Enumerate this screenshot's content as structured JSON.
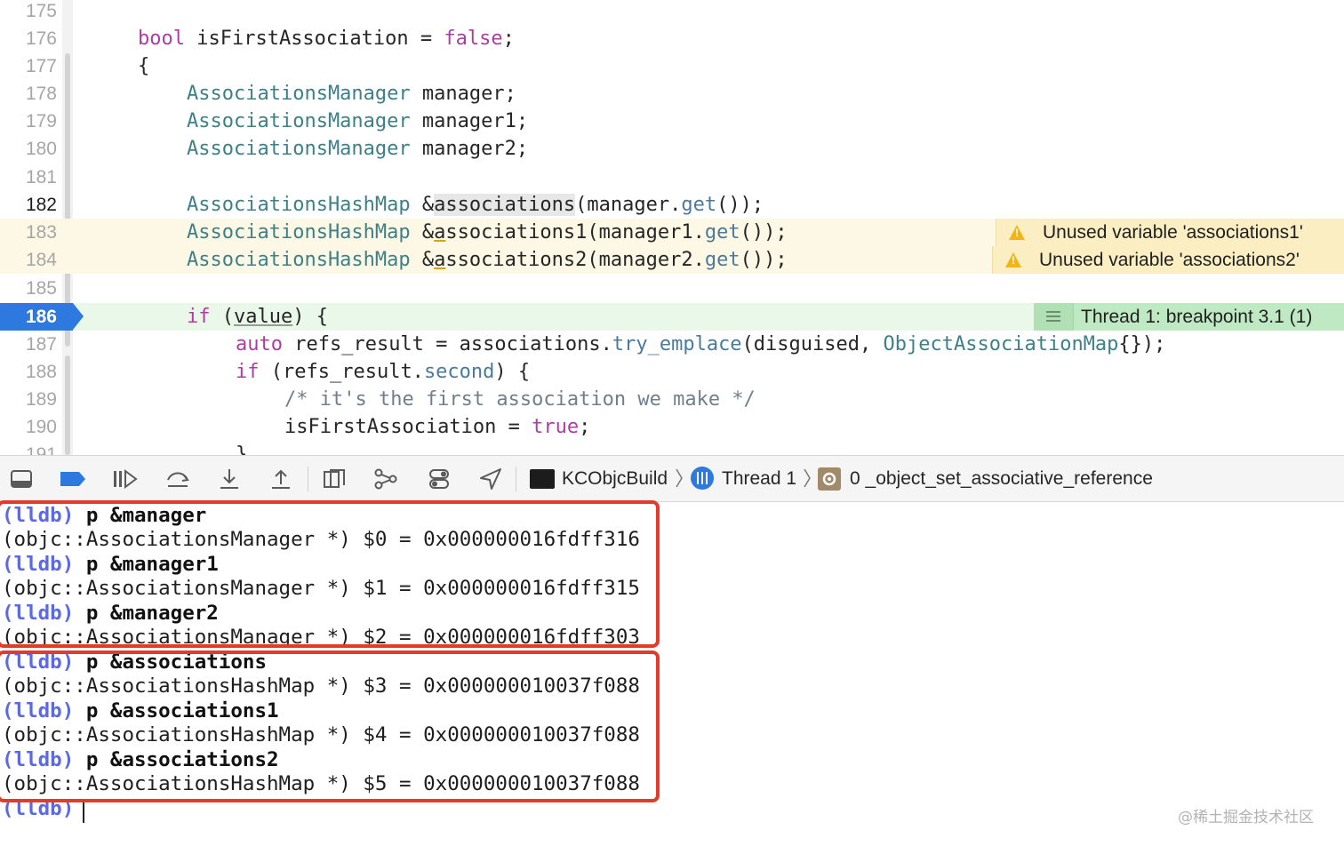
{
  "editor": {
    "lines": [
      {
        "num": "175",
        "code": ""
      },
      {
        "num": "176",
        "code": "bool isFirstAssociation = false;"
      },
      {
        "num": "177",
        "code": "{"
      },
      {
        "num": "178",
        "code": "AssociationsManager manager;"
      },
      {
        "num": "179",
        "code": "AssociationsManager manager1;"
      },
      {
        "num": "180",
        "code": "AssociationsManager manager2;"
      },
      {
        "num": "181",
        "code": ""
      },
      {
        "num": "182",
        "code": "AssociationsHashMap &associations(manager.get());"
      },
      {
        "num": "183",
        "code": "AssociationsHashMap &associations1(manager1.get());"
      },
      {
        "num": "184",
        "code": "AssociationsHashMap &associations2(manager2.get());"
      },
      {
        "num": "185",
        "code": ""
      },
      {
        "num": "186",
        "code": "if (value) {"
      },
      {
        "num": "187",
        "code": "auto refs_result = associations.try_emplace(disguised, ObjectAssociationMap{});"
      },
      {
        "num": "188",
        "code": "if (refs_result.second) {"
      },
      {
        "num": "189",
        "code": "/* it's the first association we make */"
      },
      {
        "num": "190",
        "code": "isFirstAssociation = true;"
      },
      {
        "num": "191",
        "code": "}"
      }
    ],
    "warnings": [
      {
        "line": "183",
        "text": "Unused variable 'associations1'"
      },
      {
        "line": "184",
        "text": "Unused variable 'associations2'"
      }
    ],
    "breakpoint_label": "Thread 1: breakpoint 3.1 (1)",
    "current_line": "186"
  },
  "toolbar": {
    "buttons": [
      "hide-console",
      "breakpoints-toggle",
      "continue",
      "step-over",
      "step-into",
      "step-out",
      "view-debugger",
      "memory-graph",
      "environment-overrides",
      "simulate-location"
    ],
    "breadcrumb": {
      "target": "KCObjcBuild",
      "thread": "Thread 1",
      "frame": "0 _object_set_associative_reference"
    },
    "accent": "#2e79e0"
  },
  "console": {
    "entries": [
      {
        "prompt": "(lldb)",
        "cmd": "p &manager"
      },
      {
        "output": "(objc::AssociationsManager *) $0 = 0x000000016fdff316"
      },
      {
        "prompt": "(lldb)",
        "cmd": "p &manager1"
      },
      {
        "output": "(objc::AssociationsManager *) $1 = 0x000000016fdff315"
      },
      {
        "prompt": "(lldb)",
        "cmd": "p &manager2"
      },
      {
        "output": "(objc::AssociationsManager *) $2 = 0x000000016fdff303"
      },
      {
        "prompt": "(lldb)",
        "cmd": "p &associations"
      },
      {
        "output": "(objc::AssociationsHashMap *) $3 = 0x000000010037f088"
      },
      {
        "prompt": "(lldb)",
        "cmd": "p &associations1"
      },
      {
        "output": "(objc::AssociationsHashMap *) $4 = 0x000000010037f088"
      },
      {
        "prompt": "(lldb)",
        "cmd": "p &associations2"
      },
      {
        "output": "(objc::AssociationsHashMap *) $5 = 0x000000010037f088"
      },
      {
        "prompt": "(lldb)",
        "cmd": ""
      }
    ],
    "highlight_color": "#e23b2a",
    "prompt_color": "#5b69e8",
    "watermark": "@稀土掘金技术社区"
  }
}
